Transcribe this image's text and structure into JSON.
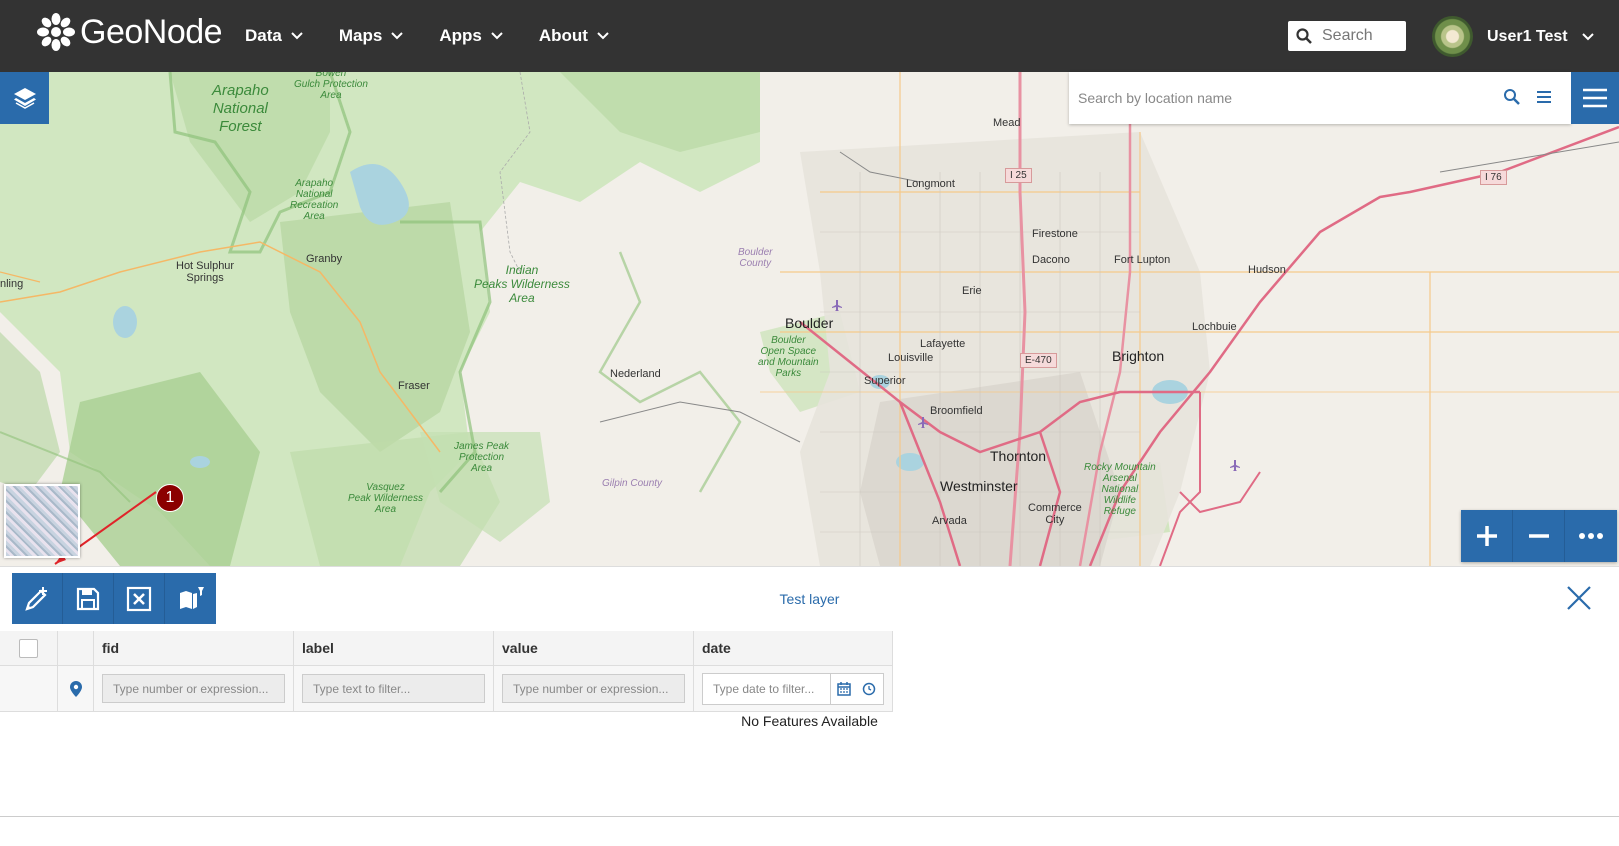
{
  "header": {
    "logo_text": "GeoNode",
    "nav": [
      {
        "label": "Data"
      },
      {
        "label": "Maps"
      },
      {
        "label": "Apps"
      },
      {
        "label": "About"
      }
    ],
    "search_placeholder": "Search",
    "user_name": "User1 Test"
  },
  "map": {
    "location_search_placeholder": "Search by location name",
    "labels": {
      "arapaho_forest": "Arapaho\nNational\nForest",
      "bowen": "Bowen\nGulch Protection\nArea",
      "arapaho_rec": "Arapaho\nNational\nRecreation\nArea",
      "indian_peaks": "Indian\nPeaks Wilderness\nArea",
      "hot_sulphur": "Hot Sulphur\nSprings",
      "granby": "Granby",
      "fraser": "Fraser",
      "nederland": "Nederland",
      "boulder_county": "Boulder\nCounty",
      "boulder": "Boulder",
      "boulder_open": "Boulder\nOpen Space\nand Mountain\nParks",
      "james_peak": "James Peak\nProtection\nArea",
      "gilpin": "Gilpin County",
      "vasquez": "Vasquez\nPeak Wilderness\nArea",
      "mead": "Mead",
      "longmont": "Longmont",
      "firestone": "Firestone",
      "dacono": "Dacono",
      "fort_lupton": "Fort Lupton",
      "hudson": "Hudson",
      "erie": "Erie",
      "lafayette": "Lafayette",
      "louisville": "Louisville",
      "superior": "Superior",
      "broomfield": "Broomfield",
      "brighton": "Brighton",
      "lochbuie": "Lochbuie",
      "thornton": "Thornton",
      "westminster": "Westminster",
      "arvada": "Arvada",
      "commerce": "Commerce\nCity",
      "rocky_mountain": "Rocky Mountain\nArsenal\nNational\nWildlife\nRefuge",
      "ning": "nling"
    },
    "shields": {
      "i25": "I 25",
      "i76": "I 76",
      "e470": "E-470"
    },
    "callout_number": "1"
  },
  "attribute_table": {
    "title": "Test layer",
    "columns": [
      "fid",
      "label",
      "value",
      "date"
    ],
    "filters": {
      "fid": "Type number or expression...",
      "label": "Type text to filter...",
      "value": "Type number or expression...",
      "date": "Type date to filter..."
    },
    "empty_message": "No Features Available"
  },
  "colors": {
    "header_bg": "#333333",
    "accent": "#2a6bab",
    "callout": "#8b0000"
  }
}
